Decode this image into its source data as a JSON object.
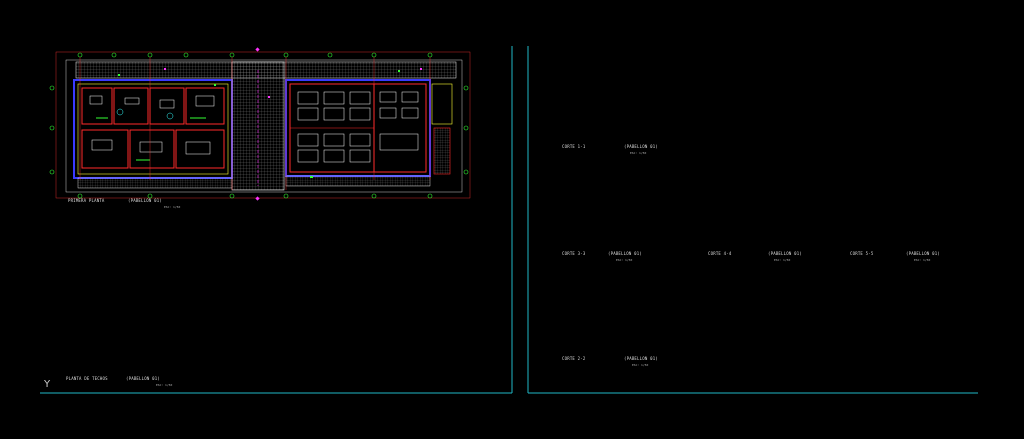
{
  "drawing": {
    "background": "#000000",
    "colors": {
      "sheet_border": "#1fb7c6",
      "wall": "#ff2a2a",
      "structure": "#3a3aff",
      "dimension": "#ff3030",
      "grid": "#ffffff",
      "text": "#dddddd",
      "accent_yellow": "#ffff33",
      "accent_green": "#33ff33",
      "accent_magenta": "#ff33ff",
      "accent_cyan": "#33ffff"
    },
    "plans": [
      {
        "id": "primera-planta",
        "title": "PRIMERA PLANTA",
        "subtitle": "(PABELLON 01)",
        "scale": "ESC: 1/50"
      },
      {
        "id": "planta-de-techos",
        "title": "PLANTA DE TECHOS",
        "subtitle": "(PABELLON 01)",
        "scale": "ESC: 1/50"
      }
    ],
    "sections": [
      {
        "id": "corte-1-1",
        "title": "CORTE 1-1",
        "subtitle": "(PABELLON 01)",
        "scale": "ESC: 1/50"
      },
      {
        "id": "corte-3-3",
        "title": "CORTE 3-3",
        "subtitle": "(PABELLON 01)",
        "scale": "ESC: 1/50"
      },
      {
        "id": "corte-4-4",
        "title": "CORTE 4-4",
        "subtitle": "(PABELLON 01)",
        "scale": "ESC: 1/50"
      },
      {
        "id": "corte-5-5",
        "title": "CORTE 5-5",
        "subtitle": "(PABELLON 01)",
        "scale": "ESC: 1/50"
      },
      {
        "id": "corte-2-2",
        "title": "CORTE 2-2",
        "subtitle": "(PABELLON 01)",
        "scale": "ESC: 1/50"
      }
    ],
    "ucs_icon": "ucs-y-axis-icon",
    "ucs_label": "Y"
  }
}
